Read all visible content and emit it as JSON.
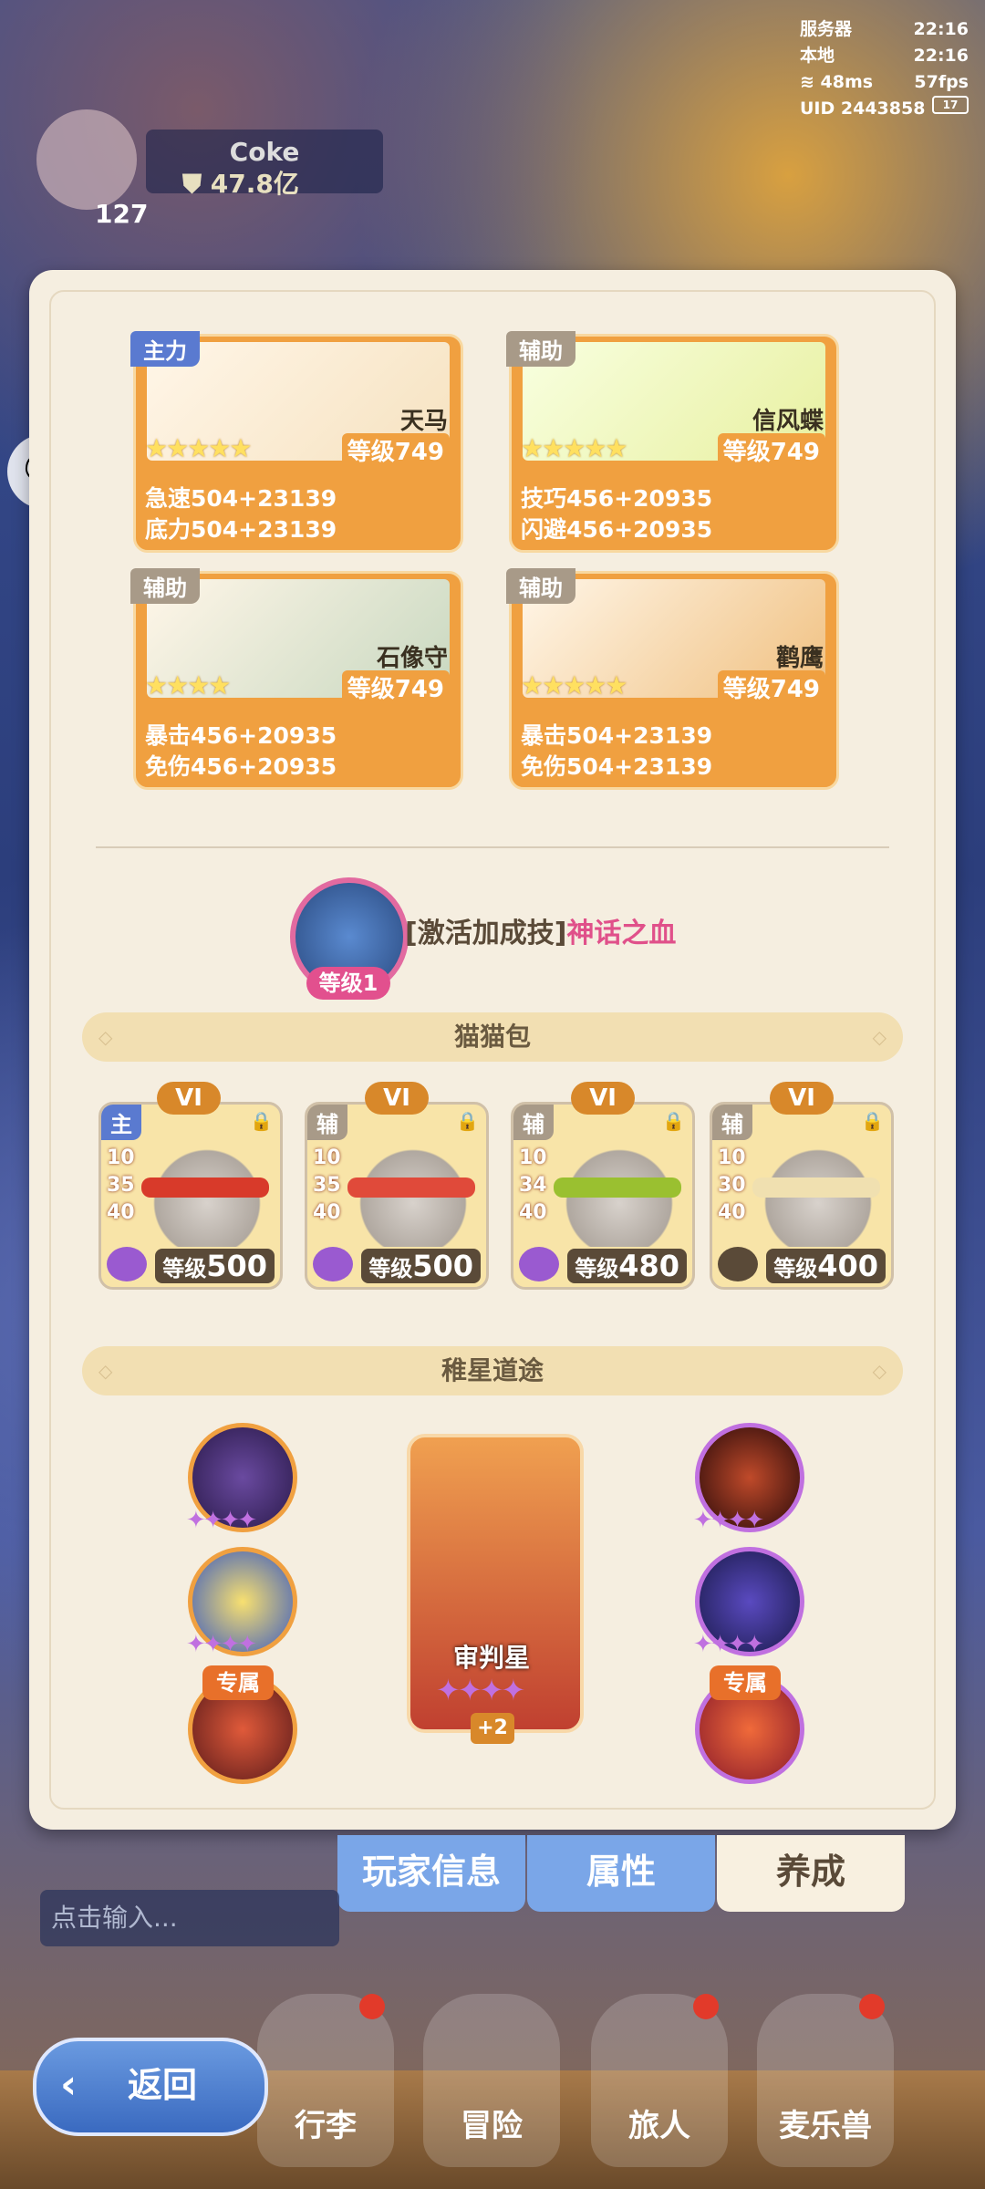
{
  "status": {
    "server_label": "服务器",
    "server_time": "22:16",
    "local_label": "本地",
    "local_time": "22:16",
    "ping": "48ms",
    "fps": "57fps",
    "uid": "UID 2443858",
    "battery": "17"
  },
  "player": {
    "name": "Coke",
    "power": "47.8亿",
    "level": "127"
  },
  "pets": [
    {
      "role": "主力",
      "name": "天马",
      "level": "等级749",
      "stars": "★★★★★",
      "stat1": "急速504+23139",
      "stat2": "底力504+23139"
    },
    {
      "role": "辅助",
      "name": "信风蝶",
      "level": "等级749",
      "stars": "★★★★★",
      "stat1": "技巧456+20935",
      "stat2": "闪避456+20935"
    },
    {
      "role": "辅助",
      "name": "石像守",
      "level": "等级749",
      "stars": "★★★★",
      "stat1": "暴击456+20935",
      "stat2": "免伤456+20935"
    },
    {
      "role": "辅助",
      "name": "鹳鹰",
      "level": "等级749",
      "stars": "★★★★★",
      "stat1": "暴击504+23139",
      "stat2": "免伤504+23139"
    }
  ],
  "skill": {
    "level": "等级1",
    "prefix": "[激活加成技]",
    "name": "神话之血"
  },
  "cat_section": {
    "title": "猫猫包"
  },
  "cats": [
    {
      "rank": "VI",
      "tag": "主",
      "nums": [
        "10",
        "35",
        "40"
      ],
      "level_prefix": "等级",
      "level": "500",
      "band": "#d83a2a"
    },
    {
      "rank": "VI",
      "tag": "辅",
      "nums": [
        "10",
        "35",
        "40"
      ],
      "level_prefix": "等级",
      "level": "500",
      "band": "#e04a3a"
    },
    {
      "rank": "VI",
      "tag": "辅",
      "nums": [
        "10",
        "34",
        "40"
      ],
      "level_prefix": "等级",
      "level": "480",
      "band": "#9ac030"
    },
    {
      "rank": "VI",
      "tag": "辅",
      "nums": [
        "10",
        "30",
        "40"
      ],
      "level_prefix": "等级",
      "level": "400",
      "band": "#f0e0b0"
    }
  ],
  "star_section": {
    "title": "稚星道途"
  },
  "star_path": {
    "exclusive_label": "专属",
    "judge_name": "审判星",
    "judge_plus": "+2",
    "mini_stars": "✦✦✦✦"
  },
  "tabs": {
    "player_info": "玩家信息",
    "attributes": "属性",
    "cultivate": "养成"
  },
  "chat": {
    "placeholder": "点击输入..."
  },
  "nav": {
    "luggage": "行李",
    "adventure": "冒险",
    "traveler": "旅人",
    "mailer": "麦乐兽"
  },
  "back": {
    "label": "返回"
  }
}
